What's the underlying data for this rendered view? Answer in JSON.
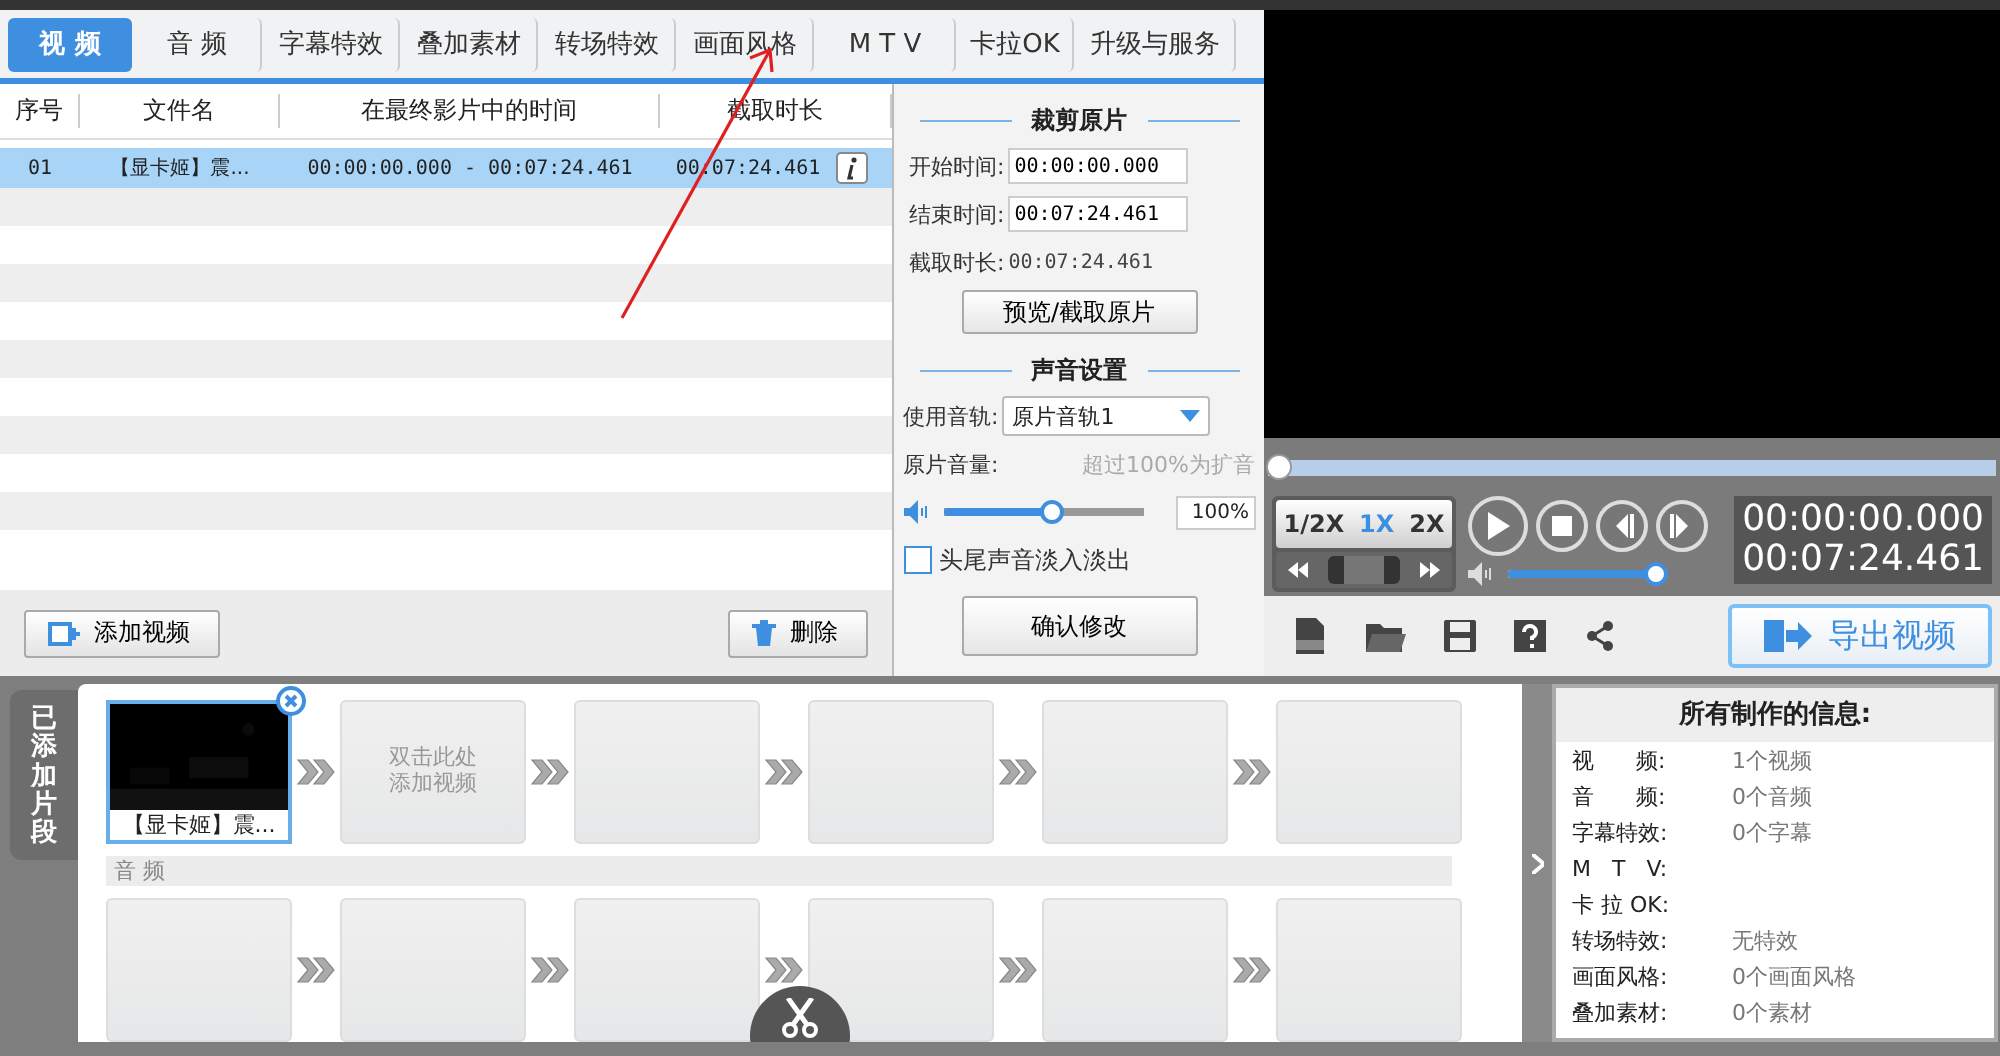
{
  "tabs": [
    {
      "label": "视  频",
      "selected": true
    },
    {
      "label": "音  频",
      "selected": false
    },
    {
      "label": "字幕特效",
      "selected": false
    },
    {
      "label": "叠加素材",
      "selected": false
    },
    {
      "label": "转场特效",
      "selected": false
    },
    {
      "label": "画面风格",
      "selected": false
    },
    {
      "label": "M T V",
      "selected": false
    },
    {
      "label": "卡拉OK",
      "selected": false
    },
    {
      "label": "升级与服务",
      "selected": false
    }
  ],
  "table": {
    "columns": [
      "序号",
      "文件名",
      "在最终影片中的时间",
      "截取时长"
    ],
    "rows": [
      {
        "cells": [
          "01",
          "【显卡姬】震...",
          "00:00:00.000 - 00:07:24.461",
          "00:07:24.461"
        ],
        "selected": true
      }
    ]
  },
  "list_buttons": {
    "add": "添加视频",
    "delete": "删除"
  },
  "clip_panel": {
    "title": "裁剪原片",
    "start_label": "开始时间:",
    "start_value": "00:00:00.000",
    "end_label": "结束时间:",
    "end_value": "00:07:24.461",
    "duration_label": "截取时长:",
    "duration_value": "00:07:24.461",
    "preview_button": "预览/截取原片",
    "sound_title": "声音设置",
    "track_label": "使用音轨:",
    "track_value": "原片音轨1",
    "volume_label": "原片音量:",
    "volume_hint": "超过100%为扩音",
    "volume": {
      "level": 0.55,
      "reading": "100%"
    },
    "fade": {
      "label": "头尾声音淡入淡出",
      "checked": false
    },
    "confirm_button": "确认修改"
  },
  "player": {
    "progress": {
      "level": 0
    },
    "speeds": [
      {
        "label": "1/2X",
        "selected": false
      },
      {
        "label": "1X",
        "selected": true
      },
      {
        "label": "2X",
        "selected": false
      }
    ],
    "current_time": "00:00:00.000",
    "total_time": "00:07:24.461",
    "volume": {
      "level": 1
    },
    "export_button": "导出视频"
  },
  "timeline": {
    "side_tab": "已添加片段",
    "video_slots": [
      {
        "kind": "clip",
        "caption": "【显卡姬】震..."
      },
      {
        "kind": "placeholder",
        "text": "双击此处添加视频"
      },
      {
        "kind": "empty"
      },
      {
        "kind": "empty"
      },
      {
        "kind": "empty"
      },
      {
        "kind": "empty"
      }
    ],
    "audio_label": "音 频",
    "audio_slots": [
      {
        "kind": "empty"
      },
      {
        "kind": "empty"
      },
      {
        "kind": "empty"
      },
      {
        "kind": "empty"
      },
      {
        "kind": "empty"
      },
      {
        "kind": "empty"
      }
    ]
  },
  "info": {
    "title": "所有制作的信息:",
    "rows": [
      {
        "label": "视      频:",
        "value": "1个视频"
      },
      {
        "label": "音      频:",
        "value": "0个音频"
      },
      {
        "label": "字幕特效:",
        "value": "0个字幕"
      },
      {
        "label": "M   T   V:"
      },
      {
        "label": "卡 拉 OK:"
      },
      {
        "label": "转场特效:",
        "value": "无特效"
      },
      {
        "label": "画面风格:",
        "value": "0个画面风格"
      },
      {
        "label": "叠加素材:",
        "value": "0个素材"
      }
    ]
  }
}
